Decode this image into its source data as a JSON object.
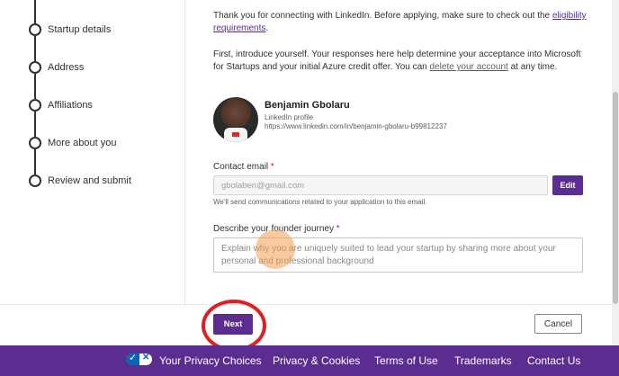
{
  "stepper": {
    "steps": [
      {
        "label": "Startup details"
      },
      {
        "label": "Address"
      },
      {
        "label": "Affiliations"
      },
      {
        "label": "More about you"
      },
      {
        "label": "Review and submit"
      }
    ]
  },
  "intro": {
    "text1": "Thank you for connecting with LinkedIn. Before applying, make sure to check out the ",
    "eligibility_link": "eligibility requirements",
    "text1_end": ".",
    "text2": "First, introduce yourself. Your responses here help determine your acceptance into Microsoft for Startups and your initial Azure credit offer. You can ",
    "delete_link": "delete your account",
    "text2_end": " at any time."
  },
  "profile": {
    "name": "Benjamin Gbolaru",
    "subtitle": "LinkedIn profile",
    "url": "https://www.linkedin.com/in/benjamin-gbolaru-b99812237"
  },
  "contact_email": {
    "label": "Contact email",
    "required_mark": "*",
    "value": "gbolaben@gmail.com",
    "edit_label": "Edit",
    "helper": "We'll send communications related to your application to this email."
  },
  "founder_journey": {
    "label": "Describe your founder journey",
    "required_mark": "*",
    "placeholder": "Explain why you are uniquely suited to lead your startup by sharing more about your personal and professional background"
  },
  "actions": {
    "next_label": "Next",
    "cancel_label": "Cancel"
  },
  "footer": {
    "privacy_choices": "Your Privacy Choices",
    "privacy_cookies": "Privacy & Cookies",
    "terms": "Terms of Use",
    "trademarks": "Trademarks",
    "contact": "Contact Us"
  },
  "colors": {
    "brand": "#5c2d91",
    "footer_bg": "#5c2d91",
    "highlight": "#e02020"
  }
}
